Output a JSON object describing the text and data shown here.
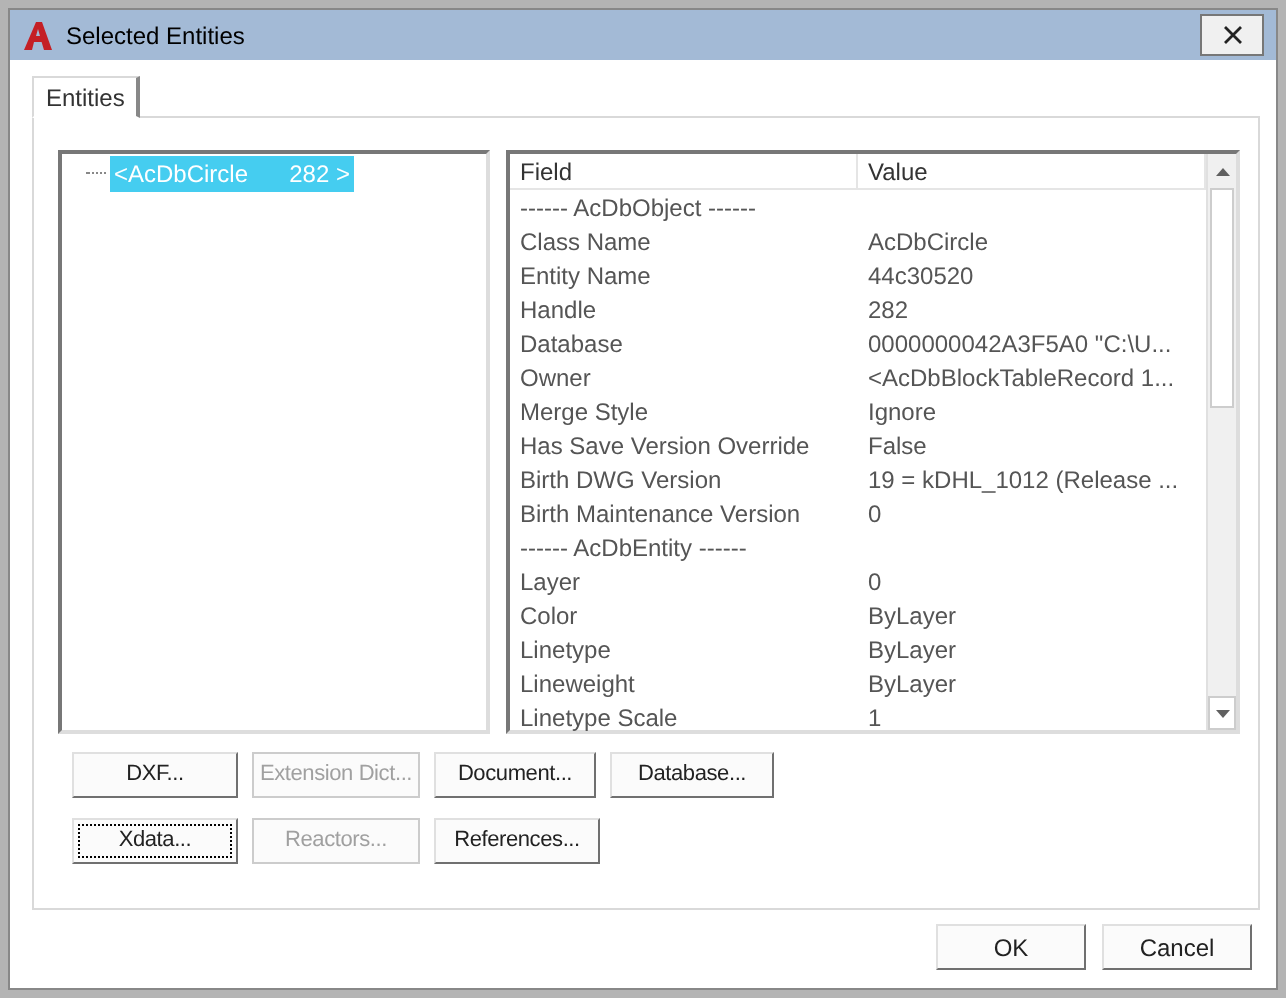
{
  "window": {
    "title": "Selected Entities"
  },
  "tabs": [
    {
      "label": "Entities",
      "selected": true
    }
  ],
  "tree": {
    "items": [
      {
        "label": "<AcDbCircle",
        "handle": "282 >",
        "selected": true
      }
    ]
  },
  "table": {
    "columns": [
      "Field",
      "Value"
    ],
    "rows": [
      {
        "kind": "section",
        "field": "------ AcDbObject ------"
      },
      {
        "kind": "field",
        "field": "Class Name",
        "value": "AcDbCircle"
      },
      {
        "kind": "field",
        "field": "Entity Name",
        "value": "44c30520"
      },
      {
        "kind": "field",
        "field": "Handle",
        "value": "282"
      },
      {
        "kind": "field",
        "field": "Database",
        "value": "0000000042A3F5A0  \"C:\\U..."
      },
      {
        "kind": "field",
        "field": "Owner",
        "value": "<AcDbBlockTableRecord 1..."
      },
      {
        "kind": "field",
        "field": "Merge Style",
        "value": "Ignore"
      },
      {
        "kind": "field",
        "field": "Has Save Version Override",
        "value": "False"
      },
      {
        "kind": "field",
        "field": "Birth DWG Version",
        "value": "19 = kDHL_1012  (Release ..."
      },
      {
        "kind": "field",
        "field": "Birth Maintenance Version",
        "value": "0"
      },
      {
        "kind": "section",
        "field": "------ AcDbEntity ------"
      },
      {
        "kind": "field",
        "field": "Layer",
        "value": "0"
      },
      {
        "kind": "field",
        "field": "Color",
        "value": "ByLayer"
      },
      {
        "kind": "field",
        "field": "Linetype",
        "value": "ByLayer"
      },
      {
        "kind": "field",
        "field": "Lineweight",
        "value": "ByLayer"
      },
      {
        "kind": "field",
        "field": "Linetype Scale",
        "value": "1"
      }
    ]
  },
  "button_rows": [
    [
      {
        "label": "DXF...",
        "disabled": false,
        "focused": false
      },
      {
        "label": "Extension Dict...",
        "disabled": true,
        "focused": false
      },
      {
        "label": "Document...",
        "disabled": false,
        "focused": false
      },
      {
        "label": "Database...",
        "disabled": false,
        "focused": false
      }
    ],
    [
      {
        "label": "Xdata...",
        "disabled": false,
        "focused": true
      },
      {
        "label": "Reactors...",
        "disabled": true,
        "focused": false
      },
      {
        "label": "References...",
        "disabled": false,
        "focused": false
      }
    ]
  ],
  "dialog_buttons": [
    "OK",
    "Cancel"
  ]
}
